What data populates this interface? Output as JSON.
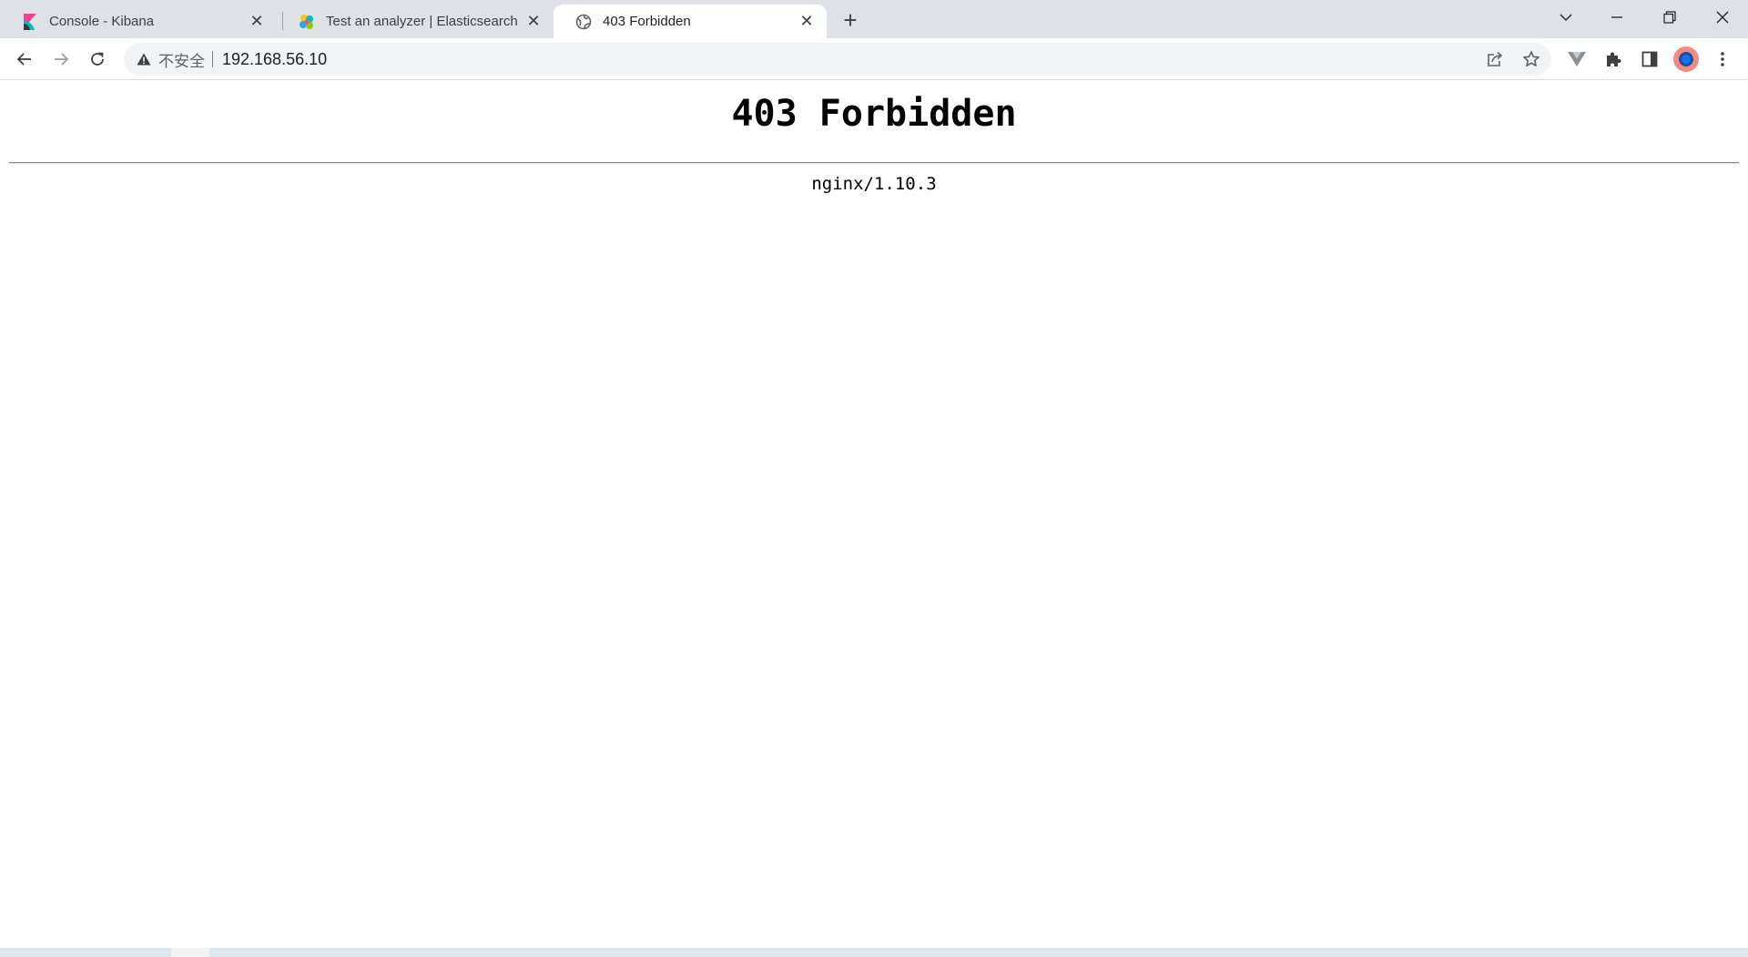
{
  "tabs": [
    {
      "title": "Console - Kibana",
      "favicon": "kibana-logo-icon",
      "active": false
    },
    {
      "title": "Test an analyzer | Elasticsearch",
      "favicon": "elastic-logo-icon",
      "active": false
    },
    {
      "title": "403 Forbidden",
      "favicon": "globe-icon",
      "active": true
    }
  ],
  "tab_close_glyph": "✕",
  "new_tab_glyph": "+",
  "window_controls": {
    "tab_search": "⌄",
    "minimize": "─",
    "restore": "❐",
    "close": "✕"
  },
  "address_bar": {
    "security_label": "不安全",
    "url": "192.168.56.10"
  },
  "page": {
    "heading": "403 Forbidden",
    "server": "nginx/1.10.3"
  },
  "colors": {
    "tabstrip": "#dee1e6",
    "omnibox": "#f1f3f4",
    "avatar": "#f28b82",
    "kibana_pink": "#e8478b",
    "kibana_teal": "#00bfb3"
  }
}
